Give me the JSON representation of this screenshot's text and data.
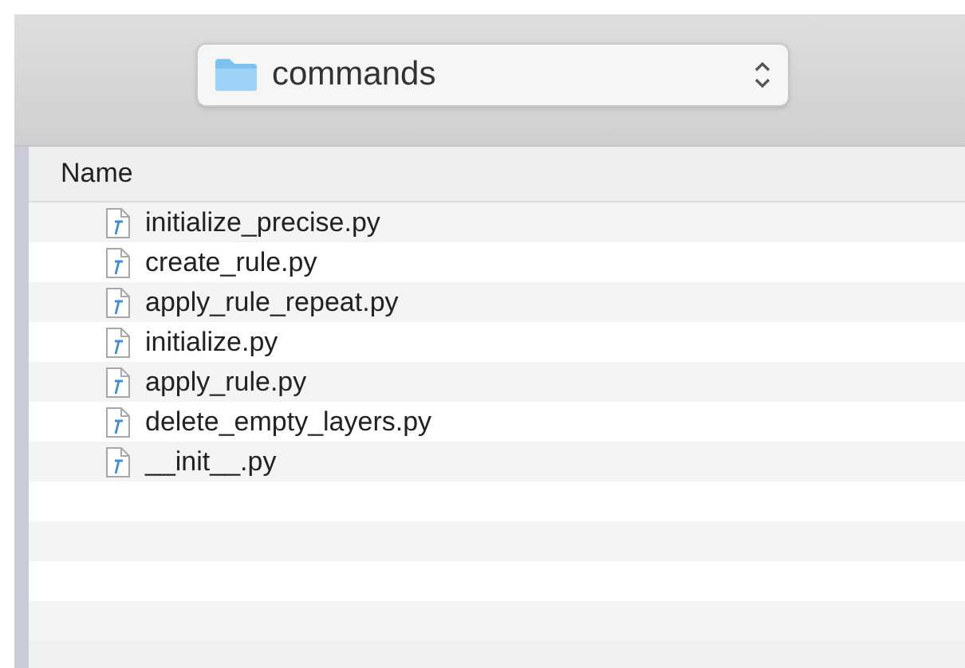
{
  "location_popup": {
    "label": "commands"
  },
  "columns": [
    "Name"
  ],
  "files": [
    {
      "name": "initialize_precise.py"
    },
    {
      "name": "create_rule.py"
    },
    {
      "name": "apply_rule_repeat.py"
    },
    {
      "name": "initialize.py"
    },
    {
      "name": "apply_rule.py"
    },
    {
      "name": "delete_empty_layers.py"
    },
    {
      "name": "__init__.py"
    }
  ]
}
